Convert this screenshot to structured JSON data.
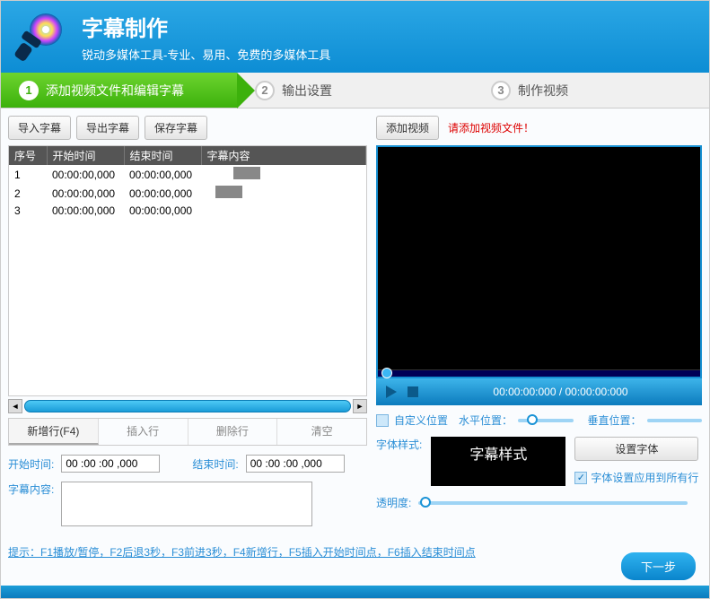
{
  "header": {
    "title": "字幕制作",
    "subtitle": "锐动多媒体工具-专业、易用、免费的多媒体工具"
  },
  "steps": [
    {
      "num": "1",
      "label": "添加视频文件和编辑字幕"
    },
    {
      "num": "2",
      "label": "输出设置"
    },
    {
      "num": "3",
      "label": "制作视频"
    }
  ],
  "toolbar": {
    "import": "导入字幕",
    "export": "导出字幕",
    "save": "保存字幕"
  },
  "table": {
    "headers": {
      "seq": "序号",
      "start": "开始时间",
      "end": "结束时间",
      "content": "字幕内容"
    },
    "rows": [
      {
        "seq": "1",
        "start": "00:00:00,000",
        "end": "00:00:00,000"
      },
      {
        "seq": "2",
        "start": "00:00:00,000",
        "end": "00:00:00,000"
      },
      {
        "seq": "3",
        "start": "00:00:00,000",
        "end": "00:00:00,000"
      }
    ]
  },
  "actions": {
    "newrow": "新增行(F4)",
    "insert": "插入行",
    "delete": "删除行",
    "clear": "清空"
  },
  "form": {
    "start_label": "开始时间:",
    "start_value": "00 :00 :00 ,000",
    "end_label": "结束时间:",
    "end_value": "00 :00 :00 ,000",
    "content_label": "字幕内容:"
  },
  "video": {
    "add_btn": "添加视频",
    "msg": "请添加视频文件！",
    "time": "00:00:00:000 / 00:00:00:000"
  },
  "pos": {
    "custom": "自定义位置",
    "h": "水平位置：",
    "v": "垂直位置："
  },
  "style": {
    "label": "字体样式:",
    "preview": "字幕样式",
    "set_btn": "设置字体",
    "apply_all": "字体设置应用到所有行"
  },
  "opacity": {
    "label": "透明度:"
  },
  "hint": "提示：F1播放/暂停，F2后退3秒，F3前进3秒，F4新增行，F5插入开始时间点，F6插入结束时间点",
  "next": "下一步"
}
